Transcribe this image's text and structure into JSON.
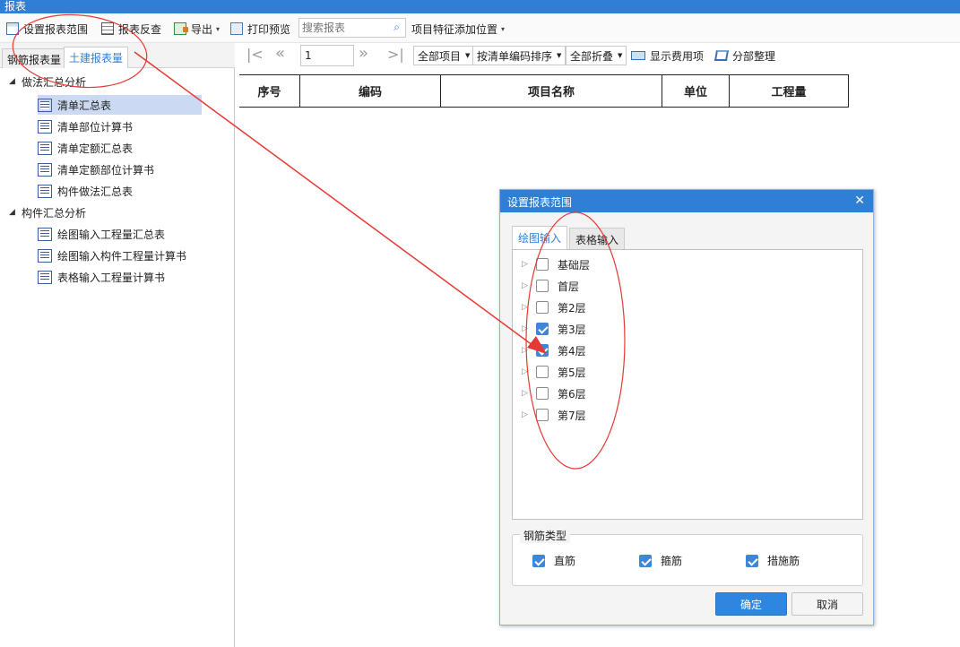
{
  "window": {
    "title": "报表"
  },
  "toolbar": {
    "set_range": "设置报表范围",
    "reverse_check": "报表反查",
    "export": "导出",
    "print_preview": "打印预览",
    "search_placeholder": "搜索报表",
    "feature_position": "项目特征添加位置"
  },
  "left_tabs": {
    "rebar": "钢筋报表量",
    "civil": "土建报表量"
  },
  "tree": {
    "group1": "做法汇总分析",
    "group1_items": [
      "清单汇总表",
      "清单部位计算书",
      "清单定额汇总表",
      "清单定额部位计算书",
      "构件做法汇总表"
    ],
    "group2": "构件汇总分析",
    "group2_items": [
      "绘图输入工程量汇总表",
      "绘图输入构件工程量计算书",
      "表格输入工程量计算书"
    ]
  },
  "grid_toolbar": {
    "page": "1",
    "all_items": "全部项目",
    "sort": "按清单编码排序",
    "fold": "全部折叠",
    "show_cost": "显示费用项",
    "section_sort": "分部整理"
  },
  "grid": {
    "columns": [
      "序号",
      "编码",
      "项目名称",
      "单位",
      "工程量"
    ]
  },
  "dialog": {
    "title": "设置报表范围",
    "tab_drawing": "绘图输入",
    "tab_table": "表格输入",
    "floors": [
      {
        "label": "基础层",
        "checked": false
      },
      {
        "label": "首层",
        "checked": false
      },
      {
        "label": "第2层",
        "checked": false
      },
      {
        "label": "第3层",
        "checked": true
      },
      {
        "label": "第4层",
        "checked": true
      },
      {
        "label": "第5层",
        "checked": false
      },
      {
        "label": "第6层",
        "checked": false
      },
      {
        "label": "第7层",
        "checked": false
      }
    ],
    "rebar_type_title": "钢筋类型",
    "rebar_types": [
      {
        "label": "直筋",
        "checked": true
      },
      {
        "label": "箍筋",
        "checked": true
      },
      {
        "label": "措施筋",
        "checked": true
      }
    ],
    "ok": "确定",
    "cancel": "取消"
  },
  "colors": {
    "accent": "#2f7fd7",
    "annotation": "#e53935"
  }
}
